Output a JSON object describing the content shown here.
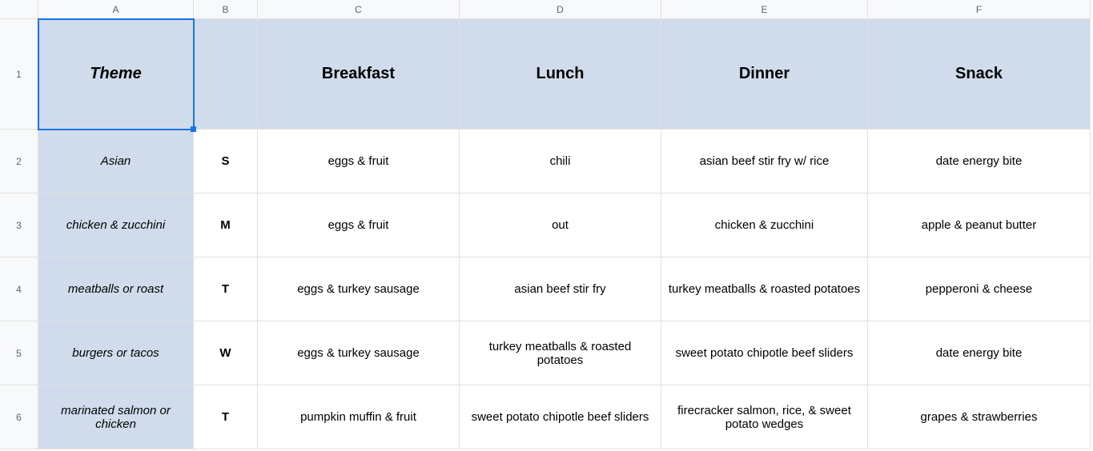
{
  "columns": [
    "A",
    "B",
    "C",
    "D",
    "E",
    "F"
  ],
  "rowNumbers": [
    "1",
    "2",
    "3",
    "4",
    "5",
    "6"
  ],
  "headers": {
    "theme": "Theme",
    "breakfast": "Breakfast",
    "lunch": "Lunch",
    "dinner": "Dinner",
    "snack": "Snack"
  },
  "rows": [
    {
      "theme": "Asian",
      "day": "S",
      "breakfast": "eggs & fruit",
      "lunch": "chili",
      "dinner": "asian beef stir fry w/ rice",
      "snack": "date energy bite"
    },
    {
      "theme": "chicken & zucchini",
      "day": "M",
      "breakfast": "eggs & fruit",
      "lunch": "out",
      "dinner": "chicken & zucchini",
      "snack": "apple & peanut butter"
    },
    {
      "theme": "meatballs or roast",
      "day": "T",
      "breakfast": "eggs & turkey sausage",
      "lunch": "asian beef stir fry",
      "dinner": "turkey meatballs & roasted potatoes",
      "snack": "pepperoni & cheese"
    },
    {
      "theme": "burgers or tacos",
      "day": "W",
      "breakfast": "eggs & turkey sausage",
      "lunch": "turkey meatballs & roasted potatoes",
      "dinner": "sweet potato chipotle beef sliders",
      "snack": "date energy bite"
    },
    {
      "theme": "marinated salmon or chicken",
      "day": "T",
      "breakfast": "pumpkin muffin & fruit",
      "lunch": "sweet potato chipotle beef sliders",
      "dinner": "firecracker salmon, rice, & sweet potato wedges",
      "snack": "grapes & strawberries"
    }
  ]
}
